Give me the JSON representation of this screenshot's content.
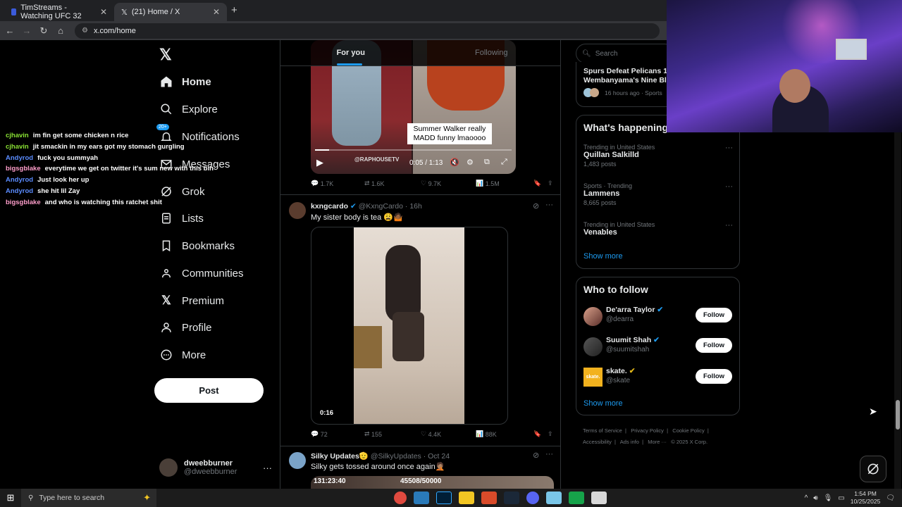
{
  "browser": {
    "tabs": [
      {
        "title": "TimStreams - Watching UFC 32"
      },
      {
        "title": "(21) Home / X"
      }
    ],
    "url": "x.com/home"
  },
  "nav": {
    "items": [
      {
        "label": "Home"
      },
      {
        "label": "Explore"
      },
      {
        "label": "Notifications",
        "badge": "20+"
      },
      {
        "label": "Messages"
      },
      {
        "label": "Grok"
      },
      {
        "label": "Lists"
      },
      {
        "label": "Bookmarks"
      },
      {
        "label": "Communities"
      },
      {
        "label": "Premium"
      },
      {
        "label": "Profile"
      },
      {
        "label": "More"
      }
    ],
    "post_label": "Post",
    "account": {
      "name": "dweebburner",
      "handle": "@dweebburner"
    }
  },
  "chat": [
    {
      "user": "cjhavin",
      "color": "#8ae234",
      "text": "im fin get some chicken n rice"
    },
    {
      "user": "cjhavin",
      "color": "#8ae234",
      "text": "jit smackin in my ears got my stomach gurgling"
    },
    {
      "user": "Andyrod",
      "color": "#5b8cff",
      "text": "fuck you summyah"
    },
    {
      "user": "bigsgblake",
      "color": "#ff9ecb",
      "text": "everytime we get on twitter it's sum new with this bih"
    },
    {
      "user": "Andyrod",
      "color": "#5b8cff",
      "text": "Just look her up"
    },
    {
      "user": "Andyrod",
      "color": "#5b8cff",
      "text": "she hit lil Zay"
    },
    {
      "user": "bigsgblake",
      "color": "#ff9ecb",
      "text": "and who is watching this ratchet shit"
    }
  ],
  "timeline": {
    "tabs": [
      "For you",
      "Following"
    ],
    "post1": {
      "caption": "Summer Walker really MADD funny lmaoooo",
      "watermark": "@RAPHOUSETV",
      "time": "0:05 / 1:13",
      "progress": 0.07,
      "replies": "1.7K",
      "reposts": "1.6K",
      "likes": "9.7K",
      "views": "1.5M"
    },
    "post2": {
      "name": "kxngcardo",
      "handle": "@KxngCardo",
      "time": "16h",
      "text": "My sister body is tea 😩🤷🏾",
      "duration": "0:16",
      "replies": "72",
      "reposts": "155",
      "likes": "4.4K",
      "views": "88K"
    },
    "post3": {
      "name": "Silky Updates🫡",
      "handle": "@SilkyUpdates",
      "time": "Oct 24",
      "text": "Silky gets tossed around once again🤦🏽",
      "stat_left": "131:23:40",
      "stat_right": "45508/50000"
    }
  },
  "right": {
    "search_placeholder": "Search",
    "news": {
      "title": "Spurs Defeat Pelicans 12",
      "subtitle": "Wembanyama's Nine Blo",
      "meta": "16 hours ago · Sports"
    },
    "whats_happening": {
      "title": "What's happening",
      "trends": [
        {
          "category": "Trending in United States",
          "name": "Quillan Salkilld",
          "posts": "1,483 posts"
        },
        {
          "category": "Sports · Trending",
          "name": "Lammens",
          "posts": "8,665 posts"
        },
        {
          "category": "Trending in United States",
          "name": "Venables",
          "posts": ""
        }
      ],
      "show_more": "Show more"
    },
    "who_to_follow": {
      "title": "Who to follow",
      "accounts": [
        {
          "name": "De'arra Taylor",
          "handle": "@dearra",
          "badge_color": "#1d9bf0"
        },
        {
          "name": "Suumit Shah",
          "handle": "@suumitshah",
          "badge_color": "#1d9bf0"
        },
        {
          "name": "skate.",
          "handle": "@skate",
          "badge_color": "#e2b719",
          "avatar_text": "skate."
        }
      ],
      "follow_label": "Follow",
      "show_more": "Show more"
    },
    "footer": {
      "links": [
        "Terms of Service",
        "Privacy Policy",
        "Cookie Policy",
        "Accessibility",
        "Ads info",
        "More ···",
        "© 2025 X Corp."
      ]
    }
  },
  "taskbar": {
    "search_placeholder": "Type here to search",
    "time": "1:54 PM",
    "date": "10/25/2025"
  }
}
